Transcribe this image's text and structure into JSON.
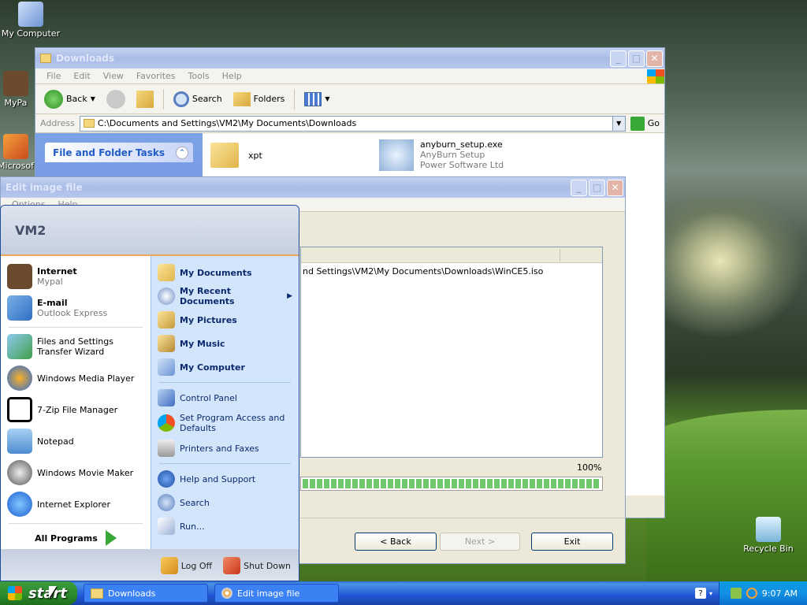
{
  "desktop": {
    "icons": [
      {
        "label": "My Computer",
        "icon": "computer-icon"
      },
      {
        "label": "MyPa",
        "icon": "raccoon-icon"
      },
      {
        "label": "Microsof",
        "icon": "shortcut-icon"
      },
      {
        "label": "Recycle Bin",
        "icon": "recycle-bin-icon"
      }
    ]
  },
  "explorer": {
    "title": "Downloads",
    "menu": [
      "File",
      "Edit",
      "View",
      "Favorites",
      "Tools",
      "Help"
    ],
    "toolbar": {
      "back": "Back",
      "search": "Search",
      "folders": "Folders"
    },
    "address": {
      "label": "Address",
      "value": "C:\\Documents and Settings\\VM2\\My Documents\\Downloads",
      "go": "Go"
    },
    "tasks_title": "File and Folder Tasks",
    "files": [
      {
        "name": "xpt",
        "type": "folder"
      },
      {
        "name": "anyburn_setup.exe",
        "desc": "AnyBurn Setup",
        "company": "Power Software Ltd"
      }
    ]
  },
  "editwin": {
    "title": "Edit image file",
    "menu": [
      "Options",
      "Help"
    ],
    "path_text": "nd Settings\\VM2\\My Documents\\Downloads\\WinCE5.iso",
    "progress": {
      "label": "100%",
      "value": 1.0
    },
    "buttons": {
      "back": "< Back",
      "next": "Next >",
      "exit": "Exit"
    }
  },
  "startmenu": {
    "user": "VM2",
    "pinned": [
      {
        "title": "Internet",
        "sub": "Mypal",
        "icon": "raccoon-icon"
      },
      {
        "title": "E-mail",
        "sub": "Outlook Express",
        "icon": "mail-icon"
      }
    ],
    "recent": [
      {
        "label": "Files and Settings Transfer Wizard",
        "icon": "transfer-icon"
      },
      {
        "label": "Windows Media Player",
        "icon": "media-player-icon"
      },
      {
        "label": "7-Zip File Manager",
        "icon": "7zip-icon"
      },
      {
        "label": "Notepad",
        "icon": "notepad-icon"
      },
      {
        "label": "Windows Movie Maker",
        "icon": "movie-maker-icon"
      },
      {
        "label": "Internet Explorer",
        "icon": "ie-icon"
      }
    ],
    "all_programs": "All Programs",
    "places": [
      {
        "label": "My Documents",
        "icon": "folder-icon"
      },
      {
        "label": "My Recent Documents",
        "icon": "recent-docs-icon"
      },
      {
        "label": "My Pictures",
        "icon": "pictures-folder-icon"
      },
      {
        "label": "My Music",
        "icon": "music-folder-icon"
      },
      {
        "label": "My Computer",
        "icon": "computer-icon"
      }
    ],
    "settings": [
      {
        "label": "Control Panel",
        "icon": "control-panel-icon"
      },
      {
        "label": "Set Program Access and Defaults",
        "icon": "program-access-icon"
      },
      {
        "label": "Printers and Faxes",
        "icon": "printer-icon"
      }
    ],
    "help": [
      {
        "label": "Help and Support",
        "icon": "help-icon"
      },
      {
        "label": "Search",
        "icon": "search-icon"
      },
      {
        "label": "Run...",
        "icon": "run-icon"
      }
    ],
    "logoff": "Log Off",
    "shutdown": "Shut Down"
  },
  "taskbar": {
    "start": "start",
    "tasks": [
      {
        "label": "Downloads",
        "icon": "folder-icon"
      },
      {
        "label": "Edit image file",
        "icon": "disc-icon"
      }
    ],
    "clock": "9:07 AM"
  },
  "colors": {
    "xp_blue": "#245edb",
    "start_green": "#2b8a2b",
    "menu_text": "#0c2a6e"
  }
}
